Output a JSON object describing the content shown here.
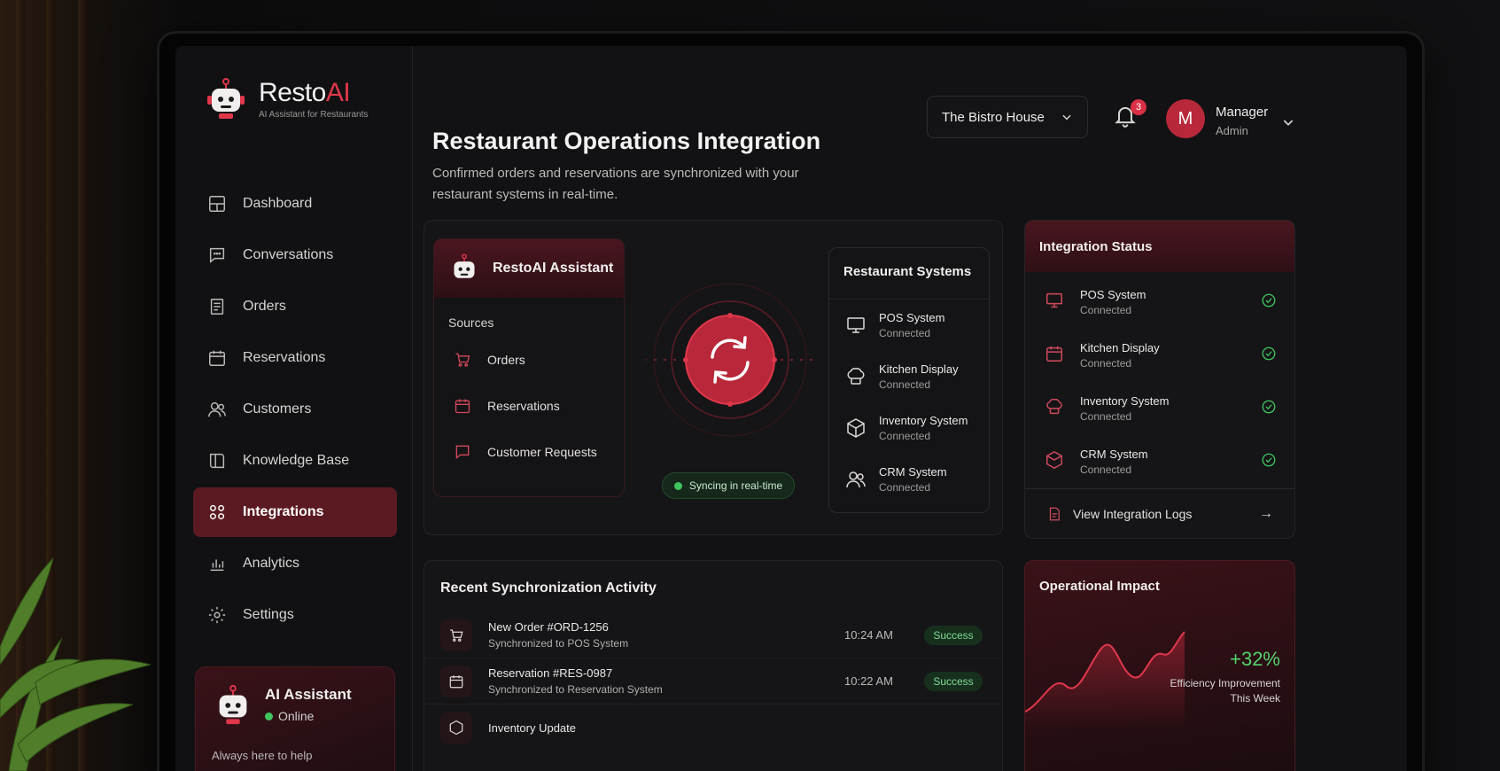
{
  "brand": {
    "name_main": "Resto",
    "name_accent": "AI",
    "tagline": "AI Assistant for Restaurants"
  },
  "nav": [
    {
      "label": "Dashboard",
      "icon": "dashboard-icon"
    },
    {
      "label": "Conversations",
      "icon": "chat-icon"
    },
    {
      "label": "Orders",
      "icon": "orders-icon"
    },
    {
      "label": "Reservations",
      "icon": "calendar-icon"
    },
    {
      "label": "Customers",
      "icon": "users-icon"
    },
    {
      "label": "Knowledge Base",
      "icon": "book-icon"
    },
    {
      "label": "Integrations",
      "icon": "integrations-icon",
      "active": true
    },
    {
      "label": "Analytics",
      "icon": "analytics-icon"
    },
    {
      "label": "Settings",
      "icon": "gear-icon"
    }
  ],
  "assistant_card": {
    "title": "AI Assistant",
    "status": "Online",
    "help": "Always here to help"
  },
  "header": {
    "title": "Restaurant Operations Integration",
    "subtitle": "Confirmed orders and reservations are synchronized with your restaurant systems in real-time.",
    "restaurant": "The Bistro House",
    "notifications": "3",
    "user_initial": "M",
    "user_name": "Manager",
    "user_role": "Admin"
  },
  "integration": {
    "assistant_title": "RestoAI Assistant",
    "sources_label": "Sources",
    "sources": [
      "Orders",
      "Reservations",
      "Customer Requests"
    ],
    "sync_label": "Syncing in real-time",
    "systems_title": "Restaurant Systems",
    "systems": [
      {
        "name": "POS System",
        "status": "Connected"
      },
      {
        "name": "Kitchen Display",
        "status": "Connected"
      },
      {
        "name": "Inventory System",
        "status": "Connected"
      },
      {
        "name": "CRM System",
        "status": "Connected"
      }
    ]
  },
  "status_panel": {
    "title": "Integration Status",
    "items": [
      {
        "name": "POS System",
        "status": "Connected"
      },
      {
        "name": "Kitchen Display",
        "status": "Connected"
      },
      {
        "name": "Inventory System",
        "status": "Connected"
      },
      {
        "name": "CRM System",
        "status": "Connected"
      }
    ],
    "logs_label": "View Integration Logs"
  },
  "activity": {
    "title": "Recent Synchronization Activity",
    "rows": [
      {
        "name": "New Order #ORD-1256",
        "sub": "Synchronized to POS System",
        "time": "10:24 AM",
        "status": "Success"
      },
      {
        "name": "Reservation #RES-0987",
        "sub": "Synchronized to Reservation System",
        "time": "10:22 AM",
        "status": "Success"
      },
      {
        "name": "Inventory Update",
        "sub": "",
        "time": "",
        "status": ""
      }
    ]
  },
  "impact": {
    "title": "Operational Impact",
    "value": "+32%",
    "label_line1": "Efficiency Improvement",
    "label_line2": "This Week"
  },
  "colors": {
    "accent": "#d93045",
    "active_nav": "#5b1a22",
    "success": "#3fc45e"
  }
}
